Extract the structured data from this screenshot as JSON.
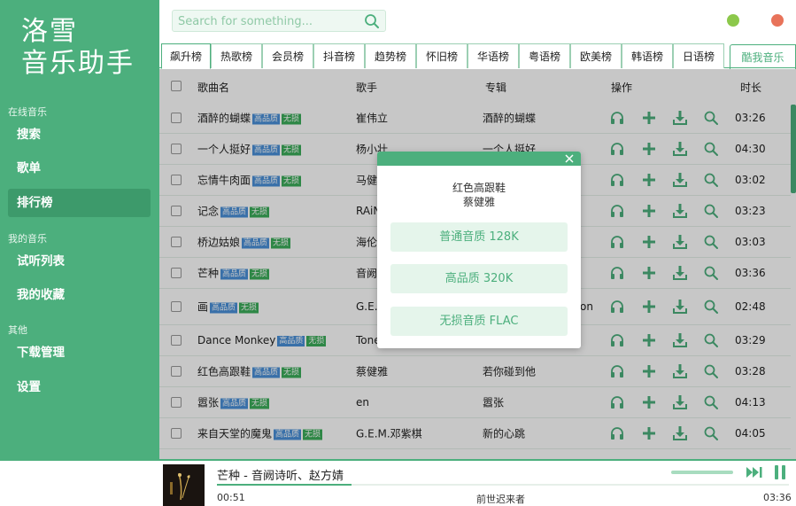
{
  "app": {
    "logo_line1": "洛雪",
    "logo_line2": "音乐助手"
  },
  "search": {
    "placeholder": "Search for something..."
  },
  "sidebar": {
    "sections": [
      {
        "label": "在线音乐",
        "items": [
          "搜索",
          "歌单",
          "排行榜"
        ]
      },
      {
        "label": "我的音乐",
        "items": [
          "试听列表",
          "我的收藏"
        ]
      },
      {
        "label": "其他",
        "items": [
          "下载管理",
          "设置"
        ]
      }
    ],
    "active_item": "排行榜"
  },
  "tabs": [
    "飙升榜",
    "热歌榜",
    "会员榜",
    "抖音榜",
    "趋势榜",
    "怀旧榜",
    "华语榜",
    "粤语榜",
    "欧美榜",
    "韩语榜",
    "日语榜"
  ],
  "tab_right": "酷我音乐",
  "table": {
    "headers": {
      "name": "歌曲名",
      "artist": "歌手",
      "album": "专辑",
      "ops": "操作",
      "duration": "时长"
    },
    "rows": [
      {
        "name": "酒醉的蝴蝶",
        "hq": true,
        "ll": true,
        "artist": "崔伟立",
        "album": "酒醉的蝴蝶",
        "duration": "03:26"
      },
      {
        "name": "一个人挺好",
        "hq": true,
        "ll": true,
        "artist": "杨小壮",
        "album": "一个人挺好",
        "duration": "04:30"
      },
      {
        "name": "忘情牛肉面",
        "hq": true,
        "ll": true,
        "artist": "马健",
        "album": "",
        "duration": "03:02"
      },
      {
        "name": "记念",
        "hq": true,
        "ll": true,
        "artist": "RAiN",
        "album": "",
        "duration": "03:23"
      },
      {
        "name": "桥边姑娘",
        "hq": true,
        "ll": true,
        "artist": "海伦",
        "album": "",
        "duration": "03:03"
      },
      {
        "name": "芒种",
        "hq": true,
        "ll": true,
        "artist": "音阙",
        "album": "",
        "duration": "03:36"
      },
      {
        "name": "画",
        "hq": true,
        "ll": true,
        "artist": "G.E.M.",
        "album": "on",
        "duration": "02:48"
      },
      {
        "name": "Dance Monkey",
        "hq": true,
        "ll": true,
        "artist": "Tone",
        "album": "",
        "duration": "03:29"
      },
      {
        "name": "红色高跟鞋",
        "hq": true,
        "ll": true,
        "artist": "蔡健雅",
        "album": "若你碰到他",
        "duration": "03:28"
      },
      {
        "name": "嚣张",
        "hq": true,
        "ll": true,
        "artist": "en",
        "album": "嚣张",
        "duration": "04:13"
      },
      {
        "name": "来自天堂的魔鬼",
        "hq": true,
        "ll": true,
        "artist": "G.E.M.邓紫棋",
        "album": "新的心跳",
        "duration": "04:05"
      }
    ],
    "badge_hq": "高品质",
    "badge_ll": "无损"
  },
  "modal": {
    "song": "红色高跟鞋",
    "artist": "蔡健雅",
    "options": [
      "普通音质 128K",
      "高品质 320K",
      "无损音质 FLAC"
    ]
  },
  "player": {
    "title": "芒种 - 音阙诗听、赵方婧",
    "current_time": "00:51",
    "lyric": "前世迟来者",
    "total_time": "03:36",
    "progress": 0.236
  },
  "colors": {
    "accent": "#4caf7d",
    "badge_hq": "#4a90d9",
    "badge_ll": "#3cae5a"
  }
}
